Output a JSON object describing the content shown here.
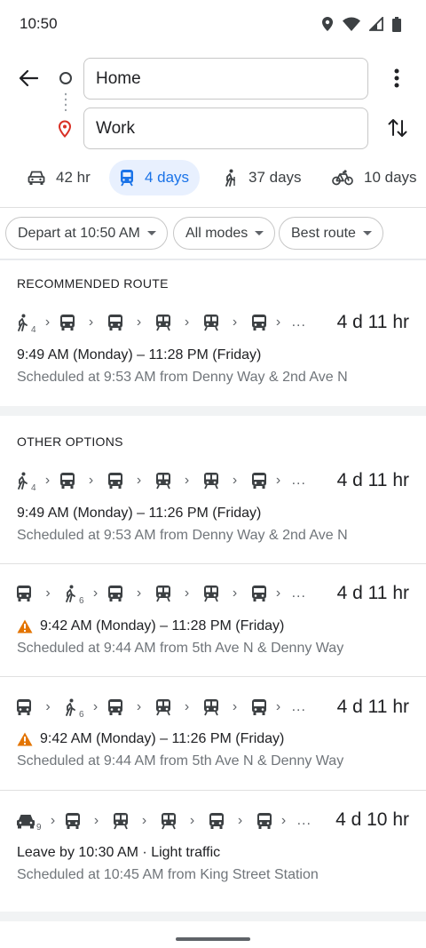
{
  "status_bar": {
    "time": "10:50"
  },
  "search": {
    "from": "Home",
    "to": "Work"
  },
  "modes": [
    {
      "icon": "car-icon",
      "label": "42 hr"
    },
    {
      "icon": "transit-icon",
      "label": "4 days"
    },
    {
      "icon": "walk-icon",
      "label": "37 days"
    },
    {
      "icon": "bike-icon",
      "label": "10 days"
    }
  ],
  "filters": {
    "depart": "Depart at 10:50 AM",
    "modes": "All modes",
    "route": "Best route"
  },
  "recommended": {
    "title": "RECOMMENDED ROUTE",
    "walk_sub": "4",
    "ellipsis": "...",
    "duration": "4 d 11 hr",
    "times": "9:49 AM (Monday) – 11:28 PM (Friday)",
    "scheduled": "Scheduled at 9:53 AM from Denny Way & 2nd Ave N"
  },
  "other": {
    "title": "OTHER OPTIONS",
    "routes": [
      {
        "sub": "4",
        "ellipsis": "...",
        "duration": "4 d 11 hr",
        "times": "9:49 AM (Monday) – 11:26 PM (Friday)",
        "scheduled": "Scheduled at 9:53 AM from Denny Way & 2nd Ave N",
        "warning": false
      },
      {
        "sub": "6",
        "ellipsis": "...",
        "duration": "4 d 11 hr",
        "times": "9:42 AM (Monday) – 11:28 PM (Friday)",
        "scheduled": "Scheduled at 9:44 AM from 5th Ave N & Denny Way",
        "warning": true
      },
      {
        "sub": "6",
        "ellipsis": "...",
        "duration": "4 d 11 hr",
        "times": "9:42 AM (Monday) – 11:26 PM (Friday)",
        "scheduled": "Scheduled at 9:44 AM from 5th Ave N & Denny Way",
        "warning": true
      },
      {
        "sub": "9",
        "ellipsis": "...",
        "duration": "4 d 10 hr",
        "times": "Leave by 10:30 AM · Light traffic",
        "scheduled": "Scheduled at 10:45 AM from King Street Station",
        "warning": false
      }
    ]
  },
  "colors": {
    "accent": "#1a73e8",
    "accent_bg": "#e8f0fe",
    "warning": "#e37400",
    "pin": "#d93025"
  }
}
